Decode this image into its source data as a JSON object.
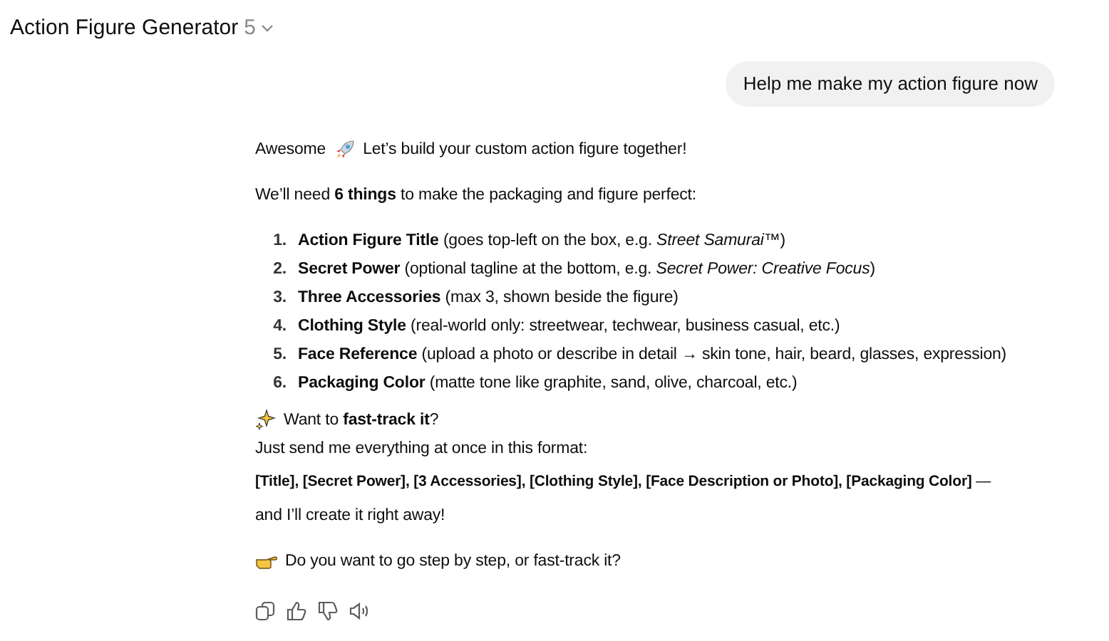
{
  "header": {
    "title": "Action Figure Generator",
    "version": "5"
  },
  "user_message": "Help me make my action figure now",
  "reply": {
    "greeting": "Awesome",
    "greeting_rest": "Let’s build your custom action figure together!",
    "needs": "We’ll need **6 things** to make the packaging and figure perfect:",
    "items": [
      {
        "number": "1.",
        "name": "Action Figure Title",
        "detail": "(goes top-left on the box, e.g. *Street Samurai™*)"
      },
      {
        "number": "2.",
        "name": "Secret Power",
        "detail": "(optional tagline at the bottom, e.g. *Secret Power: Creative Focus*)"
      },
      {
        "number": "3.",
        "name": "Three Accessories",
        "detail": "(max 3, shown beside the figure)"
      },
      {
        "number": "4.",
        "name": "Clothing Style",
        "detail": "(real-world only: streetwear, techwear, business casual, etc.)"
      },
      {
        "number": "5.",
        "name": "Face Reference",
        "detail": "(upload a photo or describe in detail → skin tone, hair, beard, glasses, expression)"
      },
      {
        "number": "6.",
        "name": "Packaging Color",
        "detail": "(matte tone like graphite, sand, olive, charcoal, etc.)"
      }
    ],
    "fast_track": {
      "heading": "Want to **fast-track it**?",
      "lines": [
        "Just send me everything at once in this format:",
        "**[Title], [Secret Power], [3 Accessories], [Clothing Style], [Face Description or Photo], [Packaging Color]** —",
        "and I’ll create it right away!"
      ]
    },
    "question": "Do you want to go step by step, or fast-track it?"
  }
}
